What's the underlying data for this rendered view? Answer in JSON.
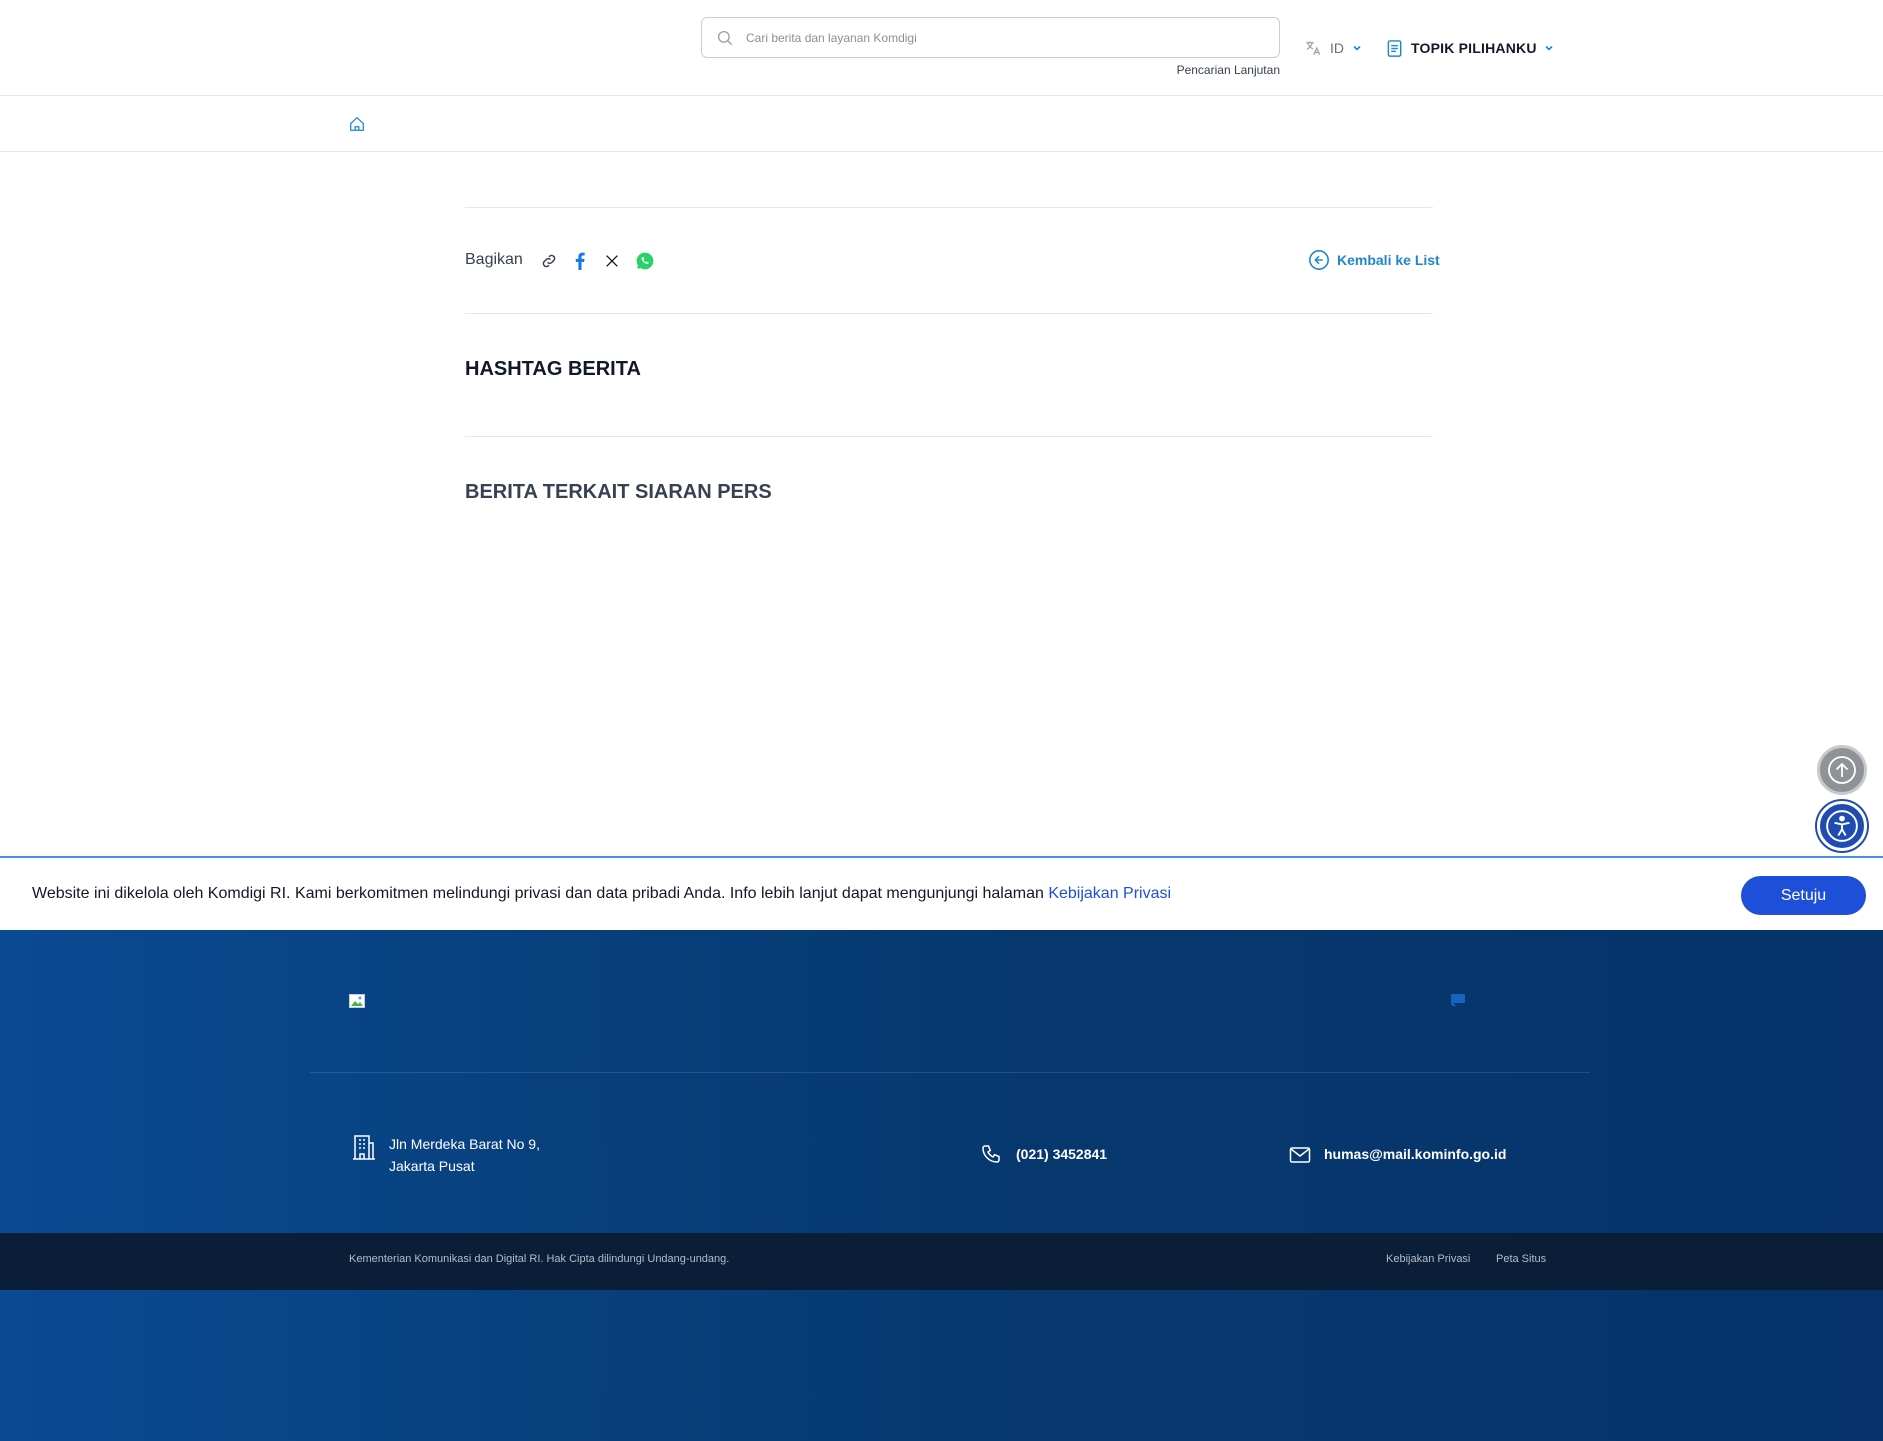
{
  "header": {
    "search_placeholder": "Cari berita dan layanan Komdigi",
    "advanced_search": "Pencarian Lanjutan",
    "language": "ID",
    "topics": "TOPIK PILIHANKU"
  },
  "content": {
    "share_label": "Bagikan",
    "share_icons": [
      "link-icon",
      "facebook-icon",
      "x-twitter-icon",
      "whatsapp-icon"
    ],
    "back_label": "Kembali ke List",
    "hashtag_title": "HASHTAG BERITA",
    "related_title": "BERITA TERKAIT SIARAN PERS"
  },
  "cookie": {
    "text": "Website ini dikelola oleh Komdigi RI. Kami berkomitmen melindungi privasi dan data pribadi Anda. Info lebih lanjut dapat mengunjungi halaman ",
    "link": "Kebijakan Privasi",
    "button": "Setuju"
  },
  "footer": {
    "address_line1": "Jln Merdeka Barat No 9,",
    "address_line2": "Jakarta Pusat",
    "phone": "(021) 3452841",
    "email": "humas@mail.kominfo.go.id",
    "copyright": "Kementerian Komunikasi dan Digital RI. Hak Cipta dilindungi Undang-undang.",
    "links": [
      "Kebijakan Privasi",
      "Peta Situs"
    ]
  },
  "colors": {
    "accent": "#1e88c8",
    "primary_button": "#1e4fd8",
    "footer_bg": "#0a4a93",
    "footer_bottom": "#0b1e37"
  }
}
